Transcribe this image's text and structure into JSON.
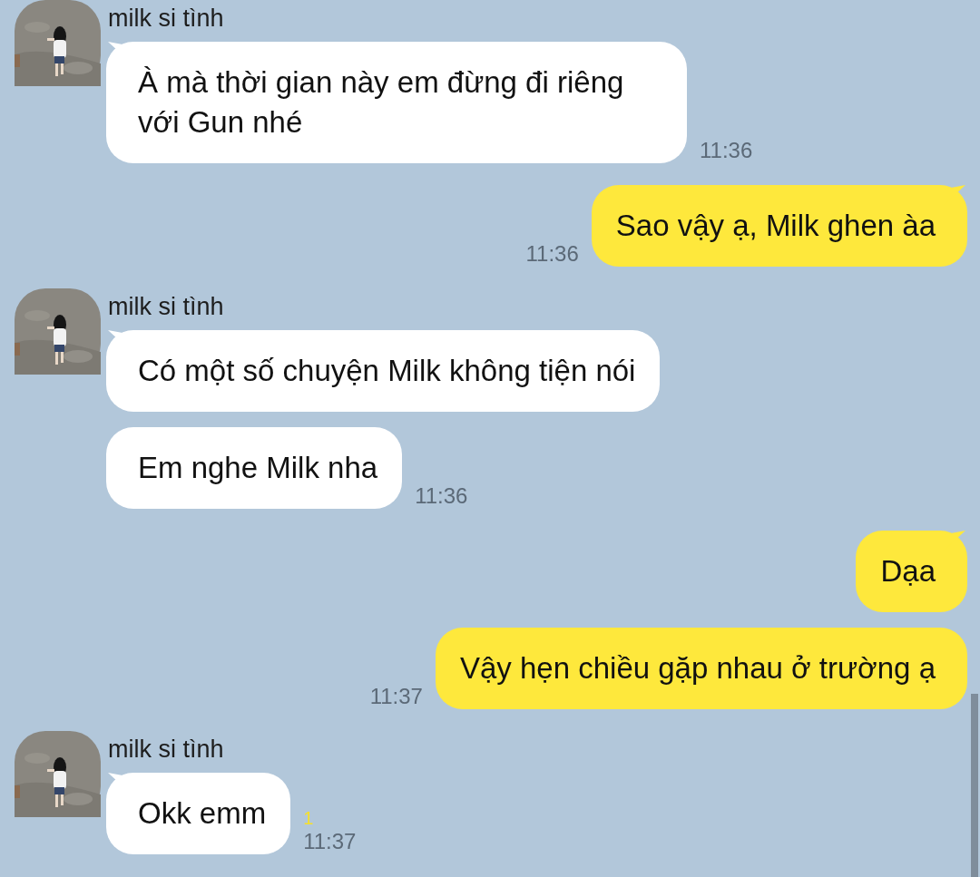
{
  "messages": [
    {
      "kind": "incoming",
      "sender": "milk si tình",
      "bubbles": [
        {
          "text": "À mà thời gian này em đừng đi riêng với Gun nhé",
          "time": "11:36"
        }
      ]
    },
    {
      "kind": "outgoing",
      "bubbles": [
        {
          "text": "Sao vậy ạ, Milk ghen àa",
          "time": "11:36"
        }
      ]
    },
    {
      "kind": "incoming",
      "sender": "milk si tình",
      "bubbles": [
        {
          "text": "Có một số chuyện Milk không tiện nói"
        },
        {
          "text": "Em nghe Milk nha",
          "time": "11:36"
        }
      ]
    },
    {
      "kind": "outgoing",
      "bubbles": [
        {
          "text": "Dạa"
        },
        {
          "text": "Vậy hẹn chiều gặp nhau ở trường ạ",
          "time": "11:37"
        }
      ]
    },
    {
      "kind": "incoming",
      "sender": "milk si tình",
      "bubbles": [
        {
          "text": "Okk emm",
          "unread": "1",
          "time": "11:37"
        }
      ]
    }
  ]
}
